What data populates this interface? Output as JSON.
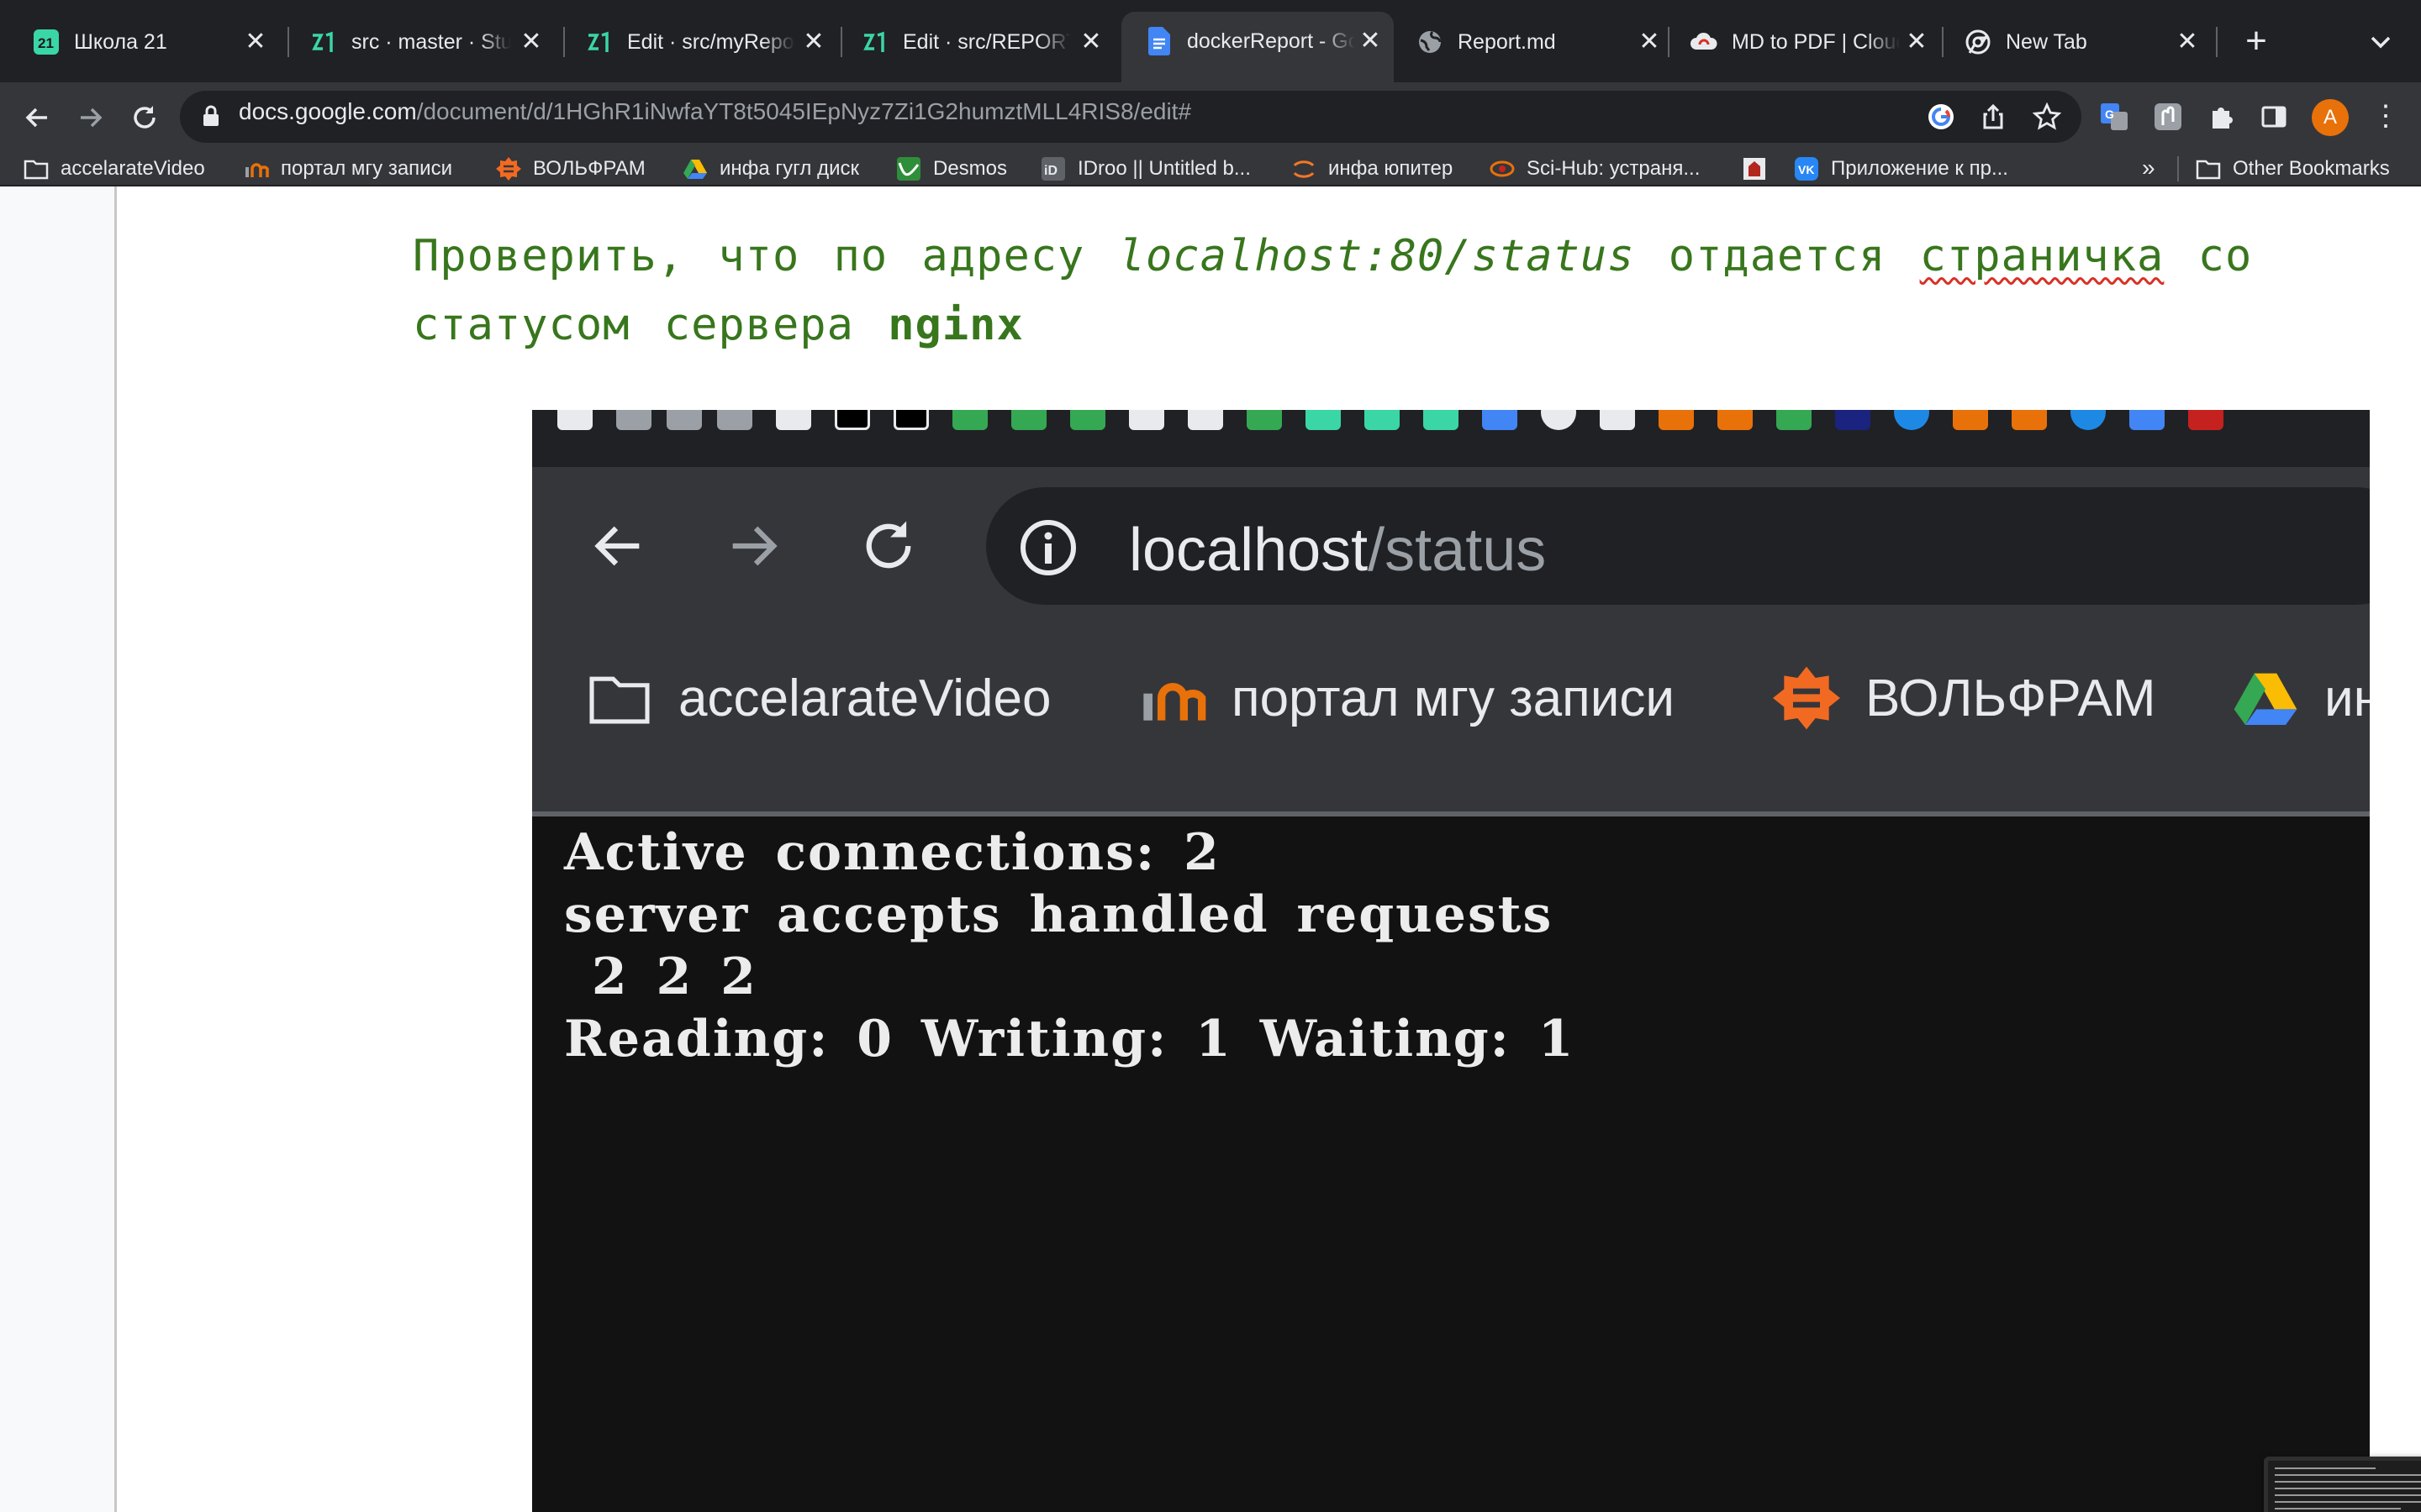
{
  "browser": {
    "tabs": [
      {
        "title": "Школа 21",
        "icon": "school21-icon",
        "active": false
      },
      {
        "title": "src · master · Student",
        "icon": "school21-icon",
        "active": false
      },
      {
        "title": "Edit · src/myReport",
        "icon": "school21-icon",
        "active": false
      },
      {
        "title": "Edit · src/REPORT",
        "icon": "school21-icon",
        "active": false
      },
      {
        "title": "dockerReport - Google Docs",
        "icon": "google-docs-icon",
        "active": true
      },
      {
        "title": "Report.md",
        "icon": "globe-icon",
        "active": false
      },
      {
        "title": "MD to PDF | CloudConvert",
        "icon": "cloudconvert-icon",
        "active": false
      },
      {
        "title": "New Tab",
        "icon": "chrome-icon",
        "active": false
      }
    ],
    "new_tab": "+",
    "address": {
      "host": "docs.google.com",
      "path": "/document/d/1HGhR1iNwfaYT8t5045IEpNyz7Zi1G2humztMLL4RIS8/edit#"
    },
    "profile_initial": "A",
    "bookmarks": [
      {
        "label": "accelarateVideo",
        "icon": "folder-icon"
      },
      {
        "label": "портал мгу записи",
        "icon": "msu-portal-icon"
      },
      {
        "label": "ВОЛЬФРАМ",
        "icon": "wolfram-icon"
      },
      {
        "label": "инфа гугл диск",
        "icon": "google-drive-icon"
      },
      {
        "label": "Desmos",
        "icon": "desmos-icon"
      },
      {
        "label": "IDroo || Untitled b...",
        "icon": "idroo-icon"
      },
      {
        "label": "инфа юпитер",
        "icon": "jupyter-icon"
      },
      {
        "label": "Sci-Hub: устраня...",
        "icon": "scihub-icon"
      },
      {
        "label": "",
        "icon": "msu-crest-icon"
      },
      {
        "label": "Приложение к пр...",
        "icon": "vk-icon"
      }
    ],
    "bookmarks_overflow": "»",
    "other_bookmarks": "Other Bookmarks"
  },
  "document": {
    "text_before": "Проверить, что по адресу ",
    "text_italic": "localhost:80/status",
    "text_middle": " отдается ",
    "text_misspelled": "страничка",
    "text_after": " со статусом сервера ",
    "text_bold": "nginx",
    "text_color": "#38761d"
  },
  "embedded_screenshot": {
    "url_host": "localhost",
    "url_path": "/status",
    "bookmarks": [
      {
        "label": "accelarateVideo",
        "icon": "folder-icon"
      },
      {
        "label": "портал мгу записи",
        "icon": "msu-portal-icon"
      },
      {
        "label": "ВОЛЬФРАМ",
        "icon": "wolfram-icon"
      },
      {
        "label": "ин",
        "icon": "google-drive-icon"
      }
    ],
    "status_lines": [
      "Active connections: 2",
      "server accepts handled requests",
      " 2 2 2",
      "Reading: 0 Writing: 1 Waiting: 1"
    ]
  }
}
